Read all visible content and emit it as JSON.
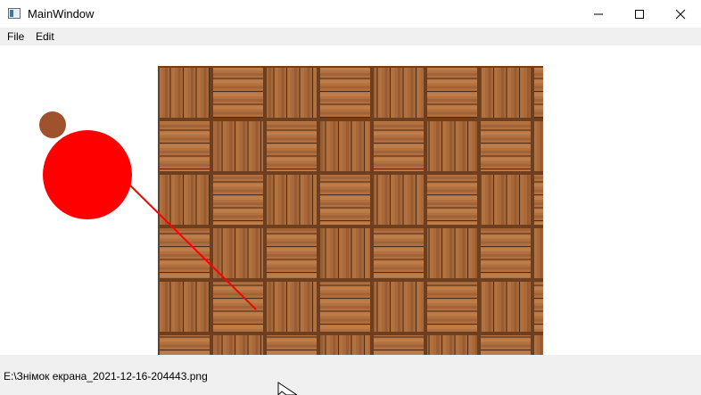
{
  "window": {
    "title": "MainWindow",
    "controls": {
      "minimize_icon": "minimize-icon",
      "maximize_icon": "maximize-icon",
      "close_icon": "close-icon"
    }
  },
  "menu": {
    "items": [
      {
        "label": "File"
      },
      {
        "label": "Edit"
      }
    ]
  },
  "canvas": {
    "image": "wooden-parquet-texture",
    "shapes": {
      "small_circle_color": "#a0522d",
      "large_circle_color": "#ff0000",
      "line_color": "#ff0000"
    }
  },
  "status": {
    "text": "E:\\Знімок екрана_2021-12-16-204443.png"
  }
}
